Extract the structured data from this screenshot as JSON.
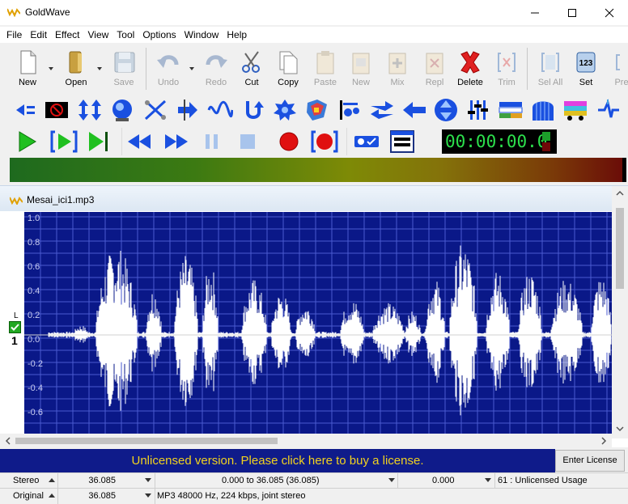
{
  "window": {
    "title": "GoldWave"
  },
  "menu": [
    "File",
    "Edit",
    "Effect",
    "View",
    "Tool",
    "Options",
    "Window",
    "Help"
  ],
  "toolbar": [
    {
      "label": "New",
      "icon": "new-file-icon",
      "enabled": true
    },
    {
      "label": "Open",
      "icon": "open-folder-icon",
      "enabled": true
    },
    {
      "label": "Save",
      "icon": "save-floppy-icon",
      "enabled": false
    },
    {
      "label": "Undo",
      "icon": "undo-arrow-icon",
      "enabled": false
    },
    {
      "label": "Redo",
      "icon": "redo-arrow-icon",
      "enabled": false
    },
    {
      "label": "Cut",
      "icon": "scissors-icon",
      "enabled": true
    },
    {
      "label": "Copy",
      "icon": "copy-icon",
      "enabled": true
    },
    {
      "label": "Paste",
      "icon": "paste-icon",
      "enabled": false
    },
    {
      "label": "New",
      "icon": "paste-new-icon",
      "enabled": false
    },
    {
      "label": "Mix",
      "icon": "mix-icon",
      "enabled": false
    },
    {
      "label": "Repl",
      "icon": "replace-icon",
      "enabled": false
    },
    {
      "label": "Delete",
      "icon": "delete-x-icon",
      "enabled": true
    },
    {
      "label": "Trim",
      "icon": "trim-icon",
      "enabled": false
    },
    {
      "label": "Sel All",
      "icon": "select-all-icon",
      "enabled": false
    },
    {
      "label": "Set",
      "icon": "set-123-icon",
      "enabled": true
    },
    {
      "label": "Pre",
      "icon": "previous-icon",
      "enabled": false
    }
  ],
  "effects_toolbar": [
    "volume-change-icon",
    "mute-icon",
    "auto-gain-icon",
    "compressor-icon",
    "crossfade-icon",
    "dynamics-icon",
    "doppler-wave-icon",
    "echo-icon",
    "equalizer-icon",
    "filter-icon",
    "mechanize-icon",
    "pan-icon",
    "reverse-icon",
    "pitch-icon",
    "resample-icon",
    "stereo-eq-icon",
    "spectrum-icon",
    "time-warp-icon",
    "reverb-icon",
    "noise-reduction-icon"
  ],
  "transport": {
    "buttons": [
      "play-icon",
      "play-selection-icon",
      "play-to-end-icon",
      "rewind-icon",
      "fast-forward-icon",
      "pause-icon",
      "stop-icon",
      "record-icon",
      "record-selection-icon",
      "monitor-icon",
      "control-properties-icon"
    ],
    "timer": "00:00:00.0"
  },
  "document": {
    "title": "Mesai_ici1.mp3",
    "channel_label": "L",
    "channel_number": "1",
    "y_ticks": [
      "1.0",
      "0.8",
      "0.6",
      "0.4",
      "0.2",
      "0.0",
      "-0.2",
      "-0.4",
      "-0.6"
    ]
  },
  "banner": {
    "text": "Unlicensed version. Please click here to buy a license.",
    "button": "Enter License"
  },
  "status": {
    "row1": {
      "channels": "Stereo",
      "length": "36.085",
      "selection": "0.000 to 36.085 (36.085)",
      "position": "0.000",
      "usage": "61 : Unlicensed Usage"
    },
    "row2": {
      "mode": "Original",
      "length": "36.085",
      "format": "MP3 48000 Hz, 224 kbps, joint stereo"
    }
  },
  "colors": {
    "wave_bg": "#0a1888",
    "wave_fg": "#ffffff",
    "banner_bg": "#0f1b8a",
    "banner_text": "#f2d21e",
    "timer_digits": "#2ce04c"
  }
}
